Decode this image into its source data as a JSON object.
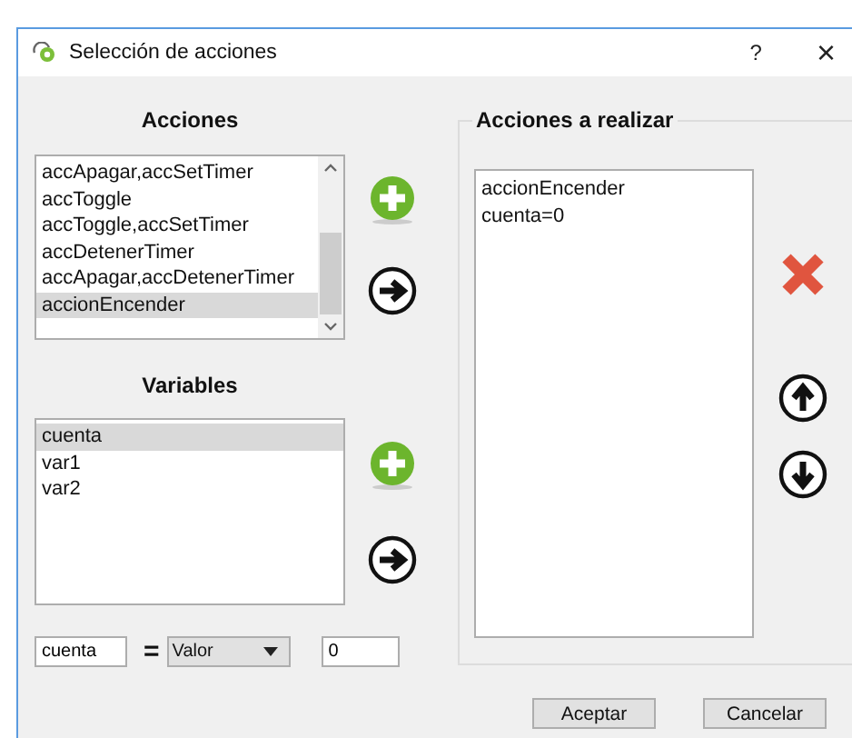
{
  "window": {
    "title": "Selección de acciones",
    "help": "?",
    "close": "×"
  },
  "acciones": {
    "heading": "Acciones",
    "items": [
      {
        "label": "accApagar,accSetTimer",
        "selected": false
      },
      {
        "label": "accToggle",
        "selected": false
      },
      {
        "label": "accToggle,accSetTimer",
        "selected": false
      },
      {
        "label": "accDetenerTimer",
        "selected": false
      },
      {
        "label": "accApagar,accDetenerTimer",
        "selected": false
      },
      {
        "label": "accionEncender",
        "selected": true
      }
    ]
  },
  "variables": {
    "heading": "Variables",
    "items": [
      {
        "label": "cuenta",
        "selected": true
      },
      {
        "label": "var1",
        "selected": false
      },
      {
        "label": "var2",
        "selected": false
      }
    ]
  },
  "assignment": {
    "variable": "cuenta",
    "equals": "=",
    "type": "Valor",
    "value": "0"
  },
  "acciones_a_realizar": {
    "heading": "Acciones a realizar",
    "items": [
      "accionEncender",
      "cuenta=0"
    ]
  },
  "buttons": [
    "Aceptar",
    "Cancelar"
  ]
}
